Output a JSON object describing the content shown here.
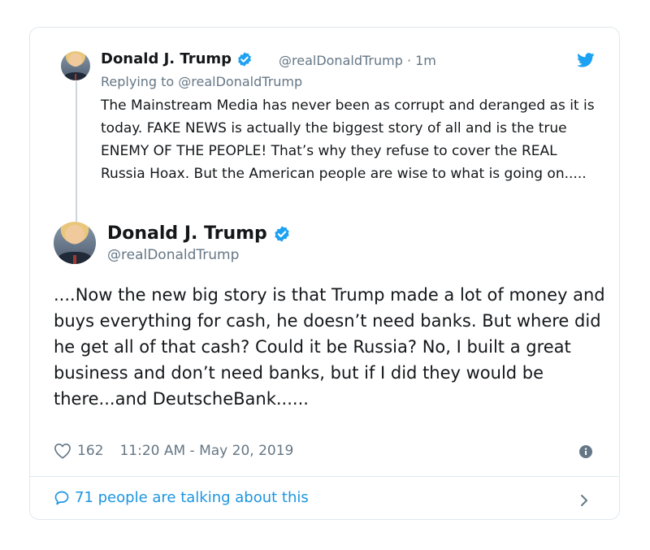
{
  "quoted": {
    "name": "Donald J. Trump",
    "handle": "@realDonaldTrump",
    "time": "· 1m",
    "replying": "Replying to @realDonaldTrump",
    "text": "The Mainstream Media has never been as corrupt and deranged as it is today. FAKE NEWS is actually the biggest story of all and is the true ENEMY OF THE PEOPLE! That’s why they refuse to cover the REAL Russia Hoax. But the American people are wise to what is going on....."
  },
  "main": {
    "name": "Donald J. Trump",
    "handle": "@realDonaldTrump",
    "text": "....Now the new big story is that Trump made a lot of money and buys everything for cash, he doesn’t need banks. But where did he get all of that cash? Could it be Russia? No, I built a great business and don’t need banks, but if I did they would be there...and DeutscheBank......",
    "likes": "162",
    "timestamp": "11:20 AM - May 20, 2019"
  },
  "footer": {
    "talking": "71 people are talking about this"
  },
  "colors": {
    "accent": "#1da1f2",
    "link": "#1b95e0",
    "muted": "#657786",
    "border": "#e1e8ed"
  },
  "icons": [
    "twitter-bird-icon",
    "verified-icon",
    "heart-icon",
    "info-icon",
    "comment-bubble-icon",
    "chevron-right-icon"
  ]
}
